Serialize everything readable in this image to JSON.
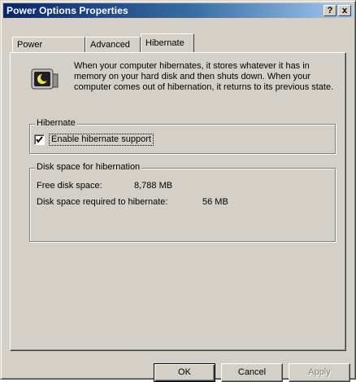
{
  "window": {
    "title": "Power Options Properties",
    "help_label": "?",
    "close_label": "x"
  },
  "tabs": [
    {
      "label": "Power Schemes",
      "active": false
    },
    {
      "label": "Advanced",
      "active": false
    },
    {
      "label": "Hibernate",
      "active": true
    }
  ],
  "hibernate": {
    "info_text": "When your computer hibernates, it stores whatever it has in memory on your hard disk and then shuts down. When your computer comes out of hibernation, it returns to its previous state.",
    "icon": "hibernate-computer-icon",
    "group_title": "Hibernate",
    "enable_label": "Enable hibernate support",
    "enable_checked": true
  },
  "disk_space": {
    "group_title": "Disk space for hibernation",
    "free_label": "Free disk space:",
    "free_value": "8,788 MB",
    "required_label": "Disk space required to hibernate:",
    "required_value": "56 MB"
  },
  "buttons": {
    "ok": "OK",
    "cancel": "Cancel",
    "apply": "Apply"
  },
  "colors": {
    "title_start": "#0a246a",
    "title_end": "#a6caf0",
    "face": "#d4d0c8"
  }
}
